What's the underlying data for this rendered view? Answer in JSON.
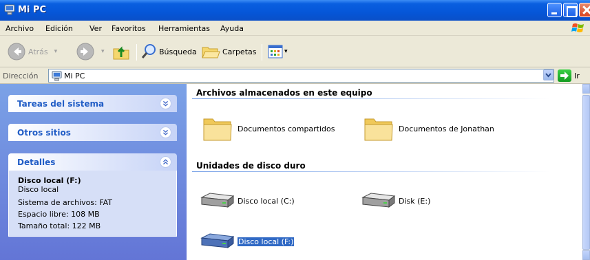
{
  "window": {
    "title": "Mi PC"
  },
  "menu": [
    "Archivo",
    "Edición",
    "Ver",
    "Favoritos",
    "Herramientas",
    "Ayuda"
  ],
  "toolbar": {
    "back_label": "Atrás",
    "search_label": "Búsqueda",
    "folders_label": "Carpetas"
  },
  "address": {
    "label": "Dirección",
    "value": "Mi PC",
    "go_label": "Ir"
  },
  "taskpane": {
    "system_tasks": "Tareas del sistema",
    "other_places": "Otros sitios",
    "details": {
      "header": "Detalles",
      "title": "Disco local (F:)",
      "type": "Disco local",
      "fs": "Sistema de archivos: FAT",
      "free": "Espacio libre: 108 MB",
      "total": "Tamaño total: 122 MB"
    }
  },
  "content": {
    "stored_header": "Archivos almacenados en este equipo",
    "folders": [
      "Documentos compartidos",
      "Documentos de Jonathan"
    ],
    "drives_header": "Unidades de disco duro",
    "drives": [
      "Disco local (C:)",
      "Disk (E:)",
      "Disco local (F:)"
    ]
  },
  "colors": {
    "titlebar": "#0556d8",
    "taskpane": "#6f8ee0",
    "selection": "#316ac5",
    "header_text": "#215dc6"
  }
}
